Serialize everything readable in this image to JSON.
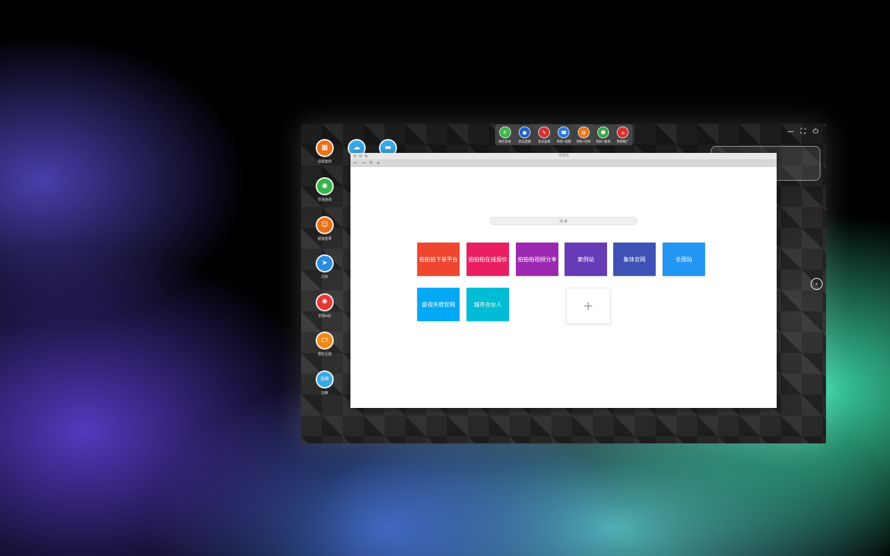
{
  "desktop_icons": [
    {
      "label": "视频案例",
      "icon": "film-icon",
      "color": "#e8711c"
    },
    {
      "label": "导演连线",
      "icon": "webcam-icon",
      "color": "#36b34a"
    },
    {
      "label": "超级蓝果",
      "icon": "team-icon",
      "color": "#e8711c"
    },
    {
      "label": "闪传",
      "icon": "telegram-icon",
      "color": "#2d8ce0"
    },
    {
      "label": "影院e站",
      "icon": "aperture-icon",
      "color": "#e53935"
    },
    {
      "label": "橙影互联",
      "icon": "cy-icon",
      "color": "#ef8a17"
    },
    {
      "label": "加推",
      "icon": "jiatui-icon",
      "color": "#3aa7e6"
    }
  ],
  "desktop_icons_row2": [
    {
      "icon": "cloud-icon",
      "color": "#3aa7e6"
    },
    {
      "icon": "folder-icon",
      "color": "#3aa7e6"
    }
  ],
  "top_dock": [
    {
      "label": "微信登录",
      "icon": "wechat-icon",
      "color": "#3bb34a"
    },
    {
      "label": "会议直播",
      "icon": "live-icon",
      "color": "#1e63c7"
    },
    {
      "label": "会议画板",
      "icon": "board-icon",
      "color": "#d33030"
    },
    {
      "label": "商机•电销",
      "icon": "phone-icon",
      "color": "#2a79d4"
    },
    {
      "label": "商机•招标",
      "icon": "bid-icon",
      "color": "#e8711c"
    },
    {
      "label": "商机•查询",
      "icon": "query-icon",
      "color": "#36a34a"
    },
    {
      "label": "我要推广",
      "icon": "promote-icon",
      "color": "#d33030"
    }
  ],
  "browser": {
    "title": "定宋站",
    "search_placeholder": "搜 索",
    "tiles": [
      {
        "label": "拍拍拍下单平台",
        "color": "#f0452e"
      },
      {
        "label": "拍拍拍在线报价",
        "color": "#e91e63"
      },
      {
        "label": "拍拍拍视频分享",
        "color": "#9c27b0"
      },
      {
        "label": "案例站",
        "color": "#673ab7"
      },
      {
        "label": "集体官网",
        "color": "#3f51b5"
      },
      {
        "label": "全国站",
        "color": "#2196f3"
      },
      {
        "label": "盛视天橙官网",
        "color": "#03a9f4"
      },
      {
        "label": "城市合伙人",
        "color": "#00bcd4"
      }
    ],
    "add_symbol": "+"
  },
  "window_controls": {
    "minimize": "—",
    "fullscreen": "⛶",
    "power": "⏻"
  },
  "side_arrow": "‹"
}
